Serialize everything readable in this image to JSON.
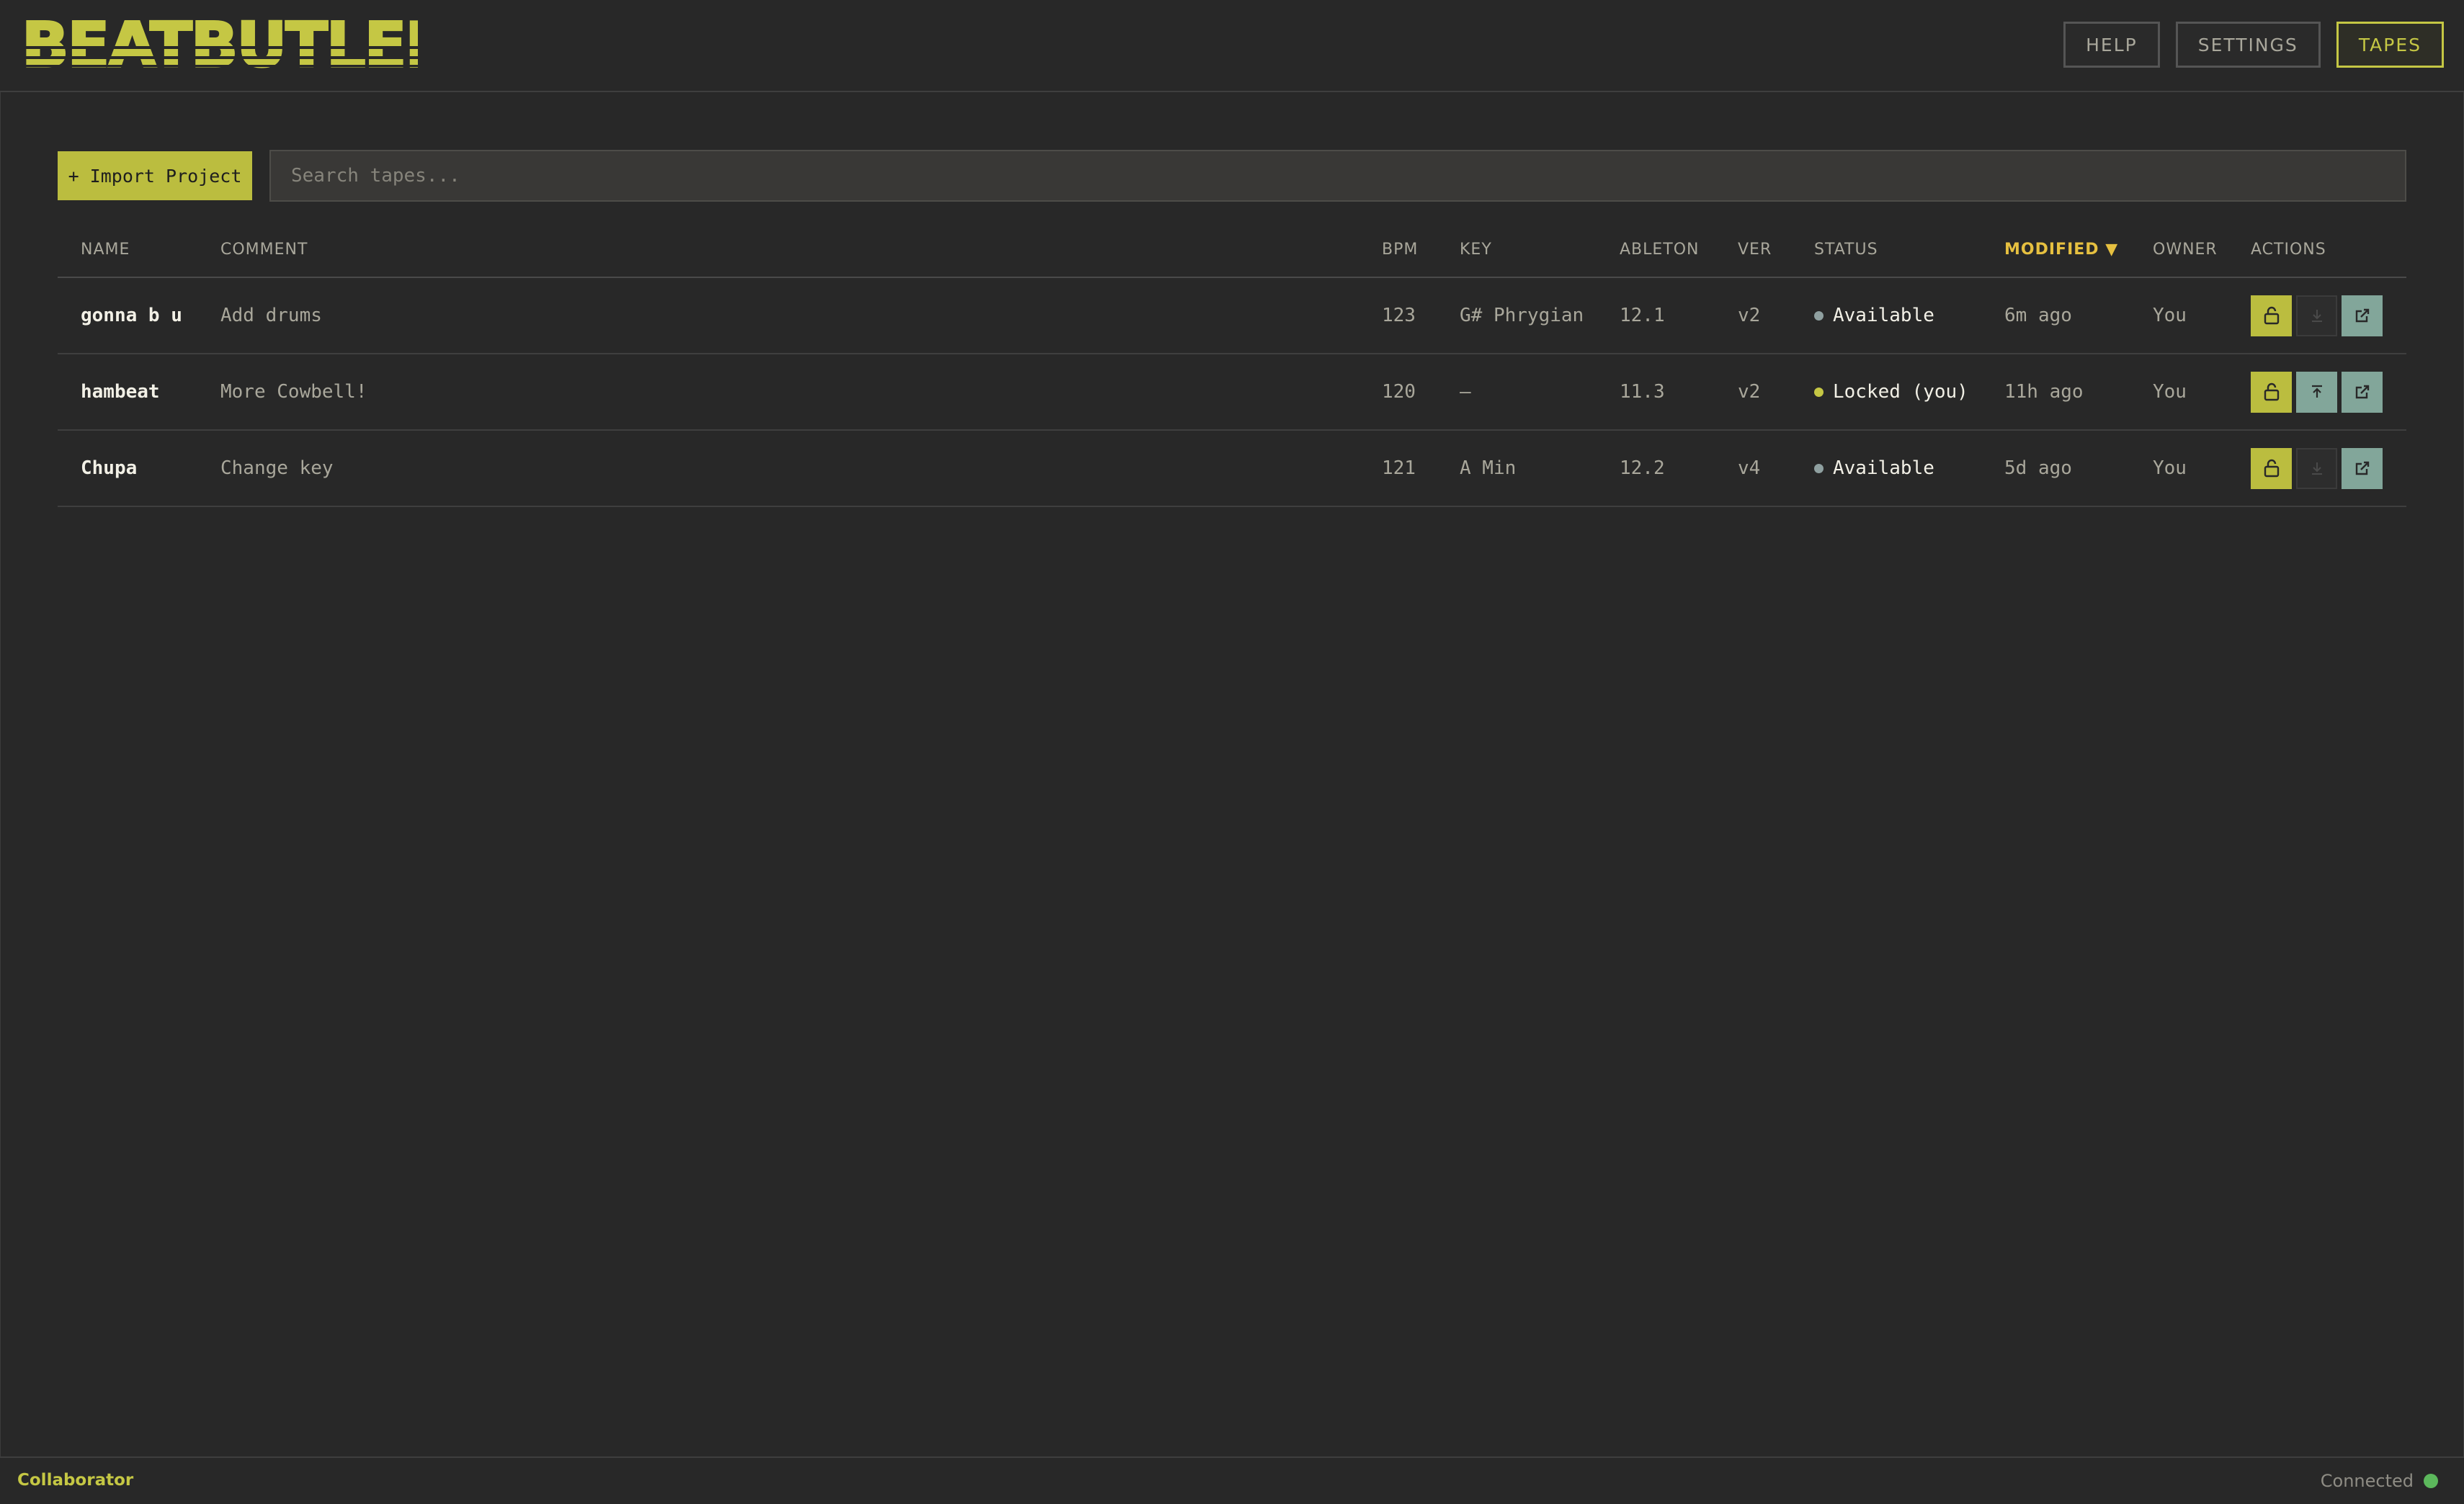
{
  "app": {
    "logo_text": "BEATBUTLER",
    "nav": [
      {
        "label": "HELP",
        "active": false
      },
      {
        "label": "SETTINGS",
        "active": false
      },
      {
        "label": "TAPES",
        "active": true
      }
    ]
  },
  "toolbar": {
    "import_label": "+ Import Project",
    "search_placeholder": "Search tapes...",
    "search_value": ""
  },
  "table": {
    "headers": {
      "name": "NAME",
      "comment": "COMMENT",
      "bpm": "BPM",
      "key": "KEY",
      "ableton": "ABLETON",
      "ver": "VER",
      "status": "STATUS",
      "modified": "MODIFIED ▼",
      "owner": "OWNER",
      "actions": "ACTIONS"
    },
    "sorted_column": "modified",
    "rows": [
      {
        "name": "gonna b u",
        "comment": "Add drums",
        "bpm": "123",
        "key": "G# Phrygian",
        "ableton": "12.1",
        "ver": "v2",
        "status": "Available",
        "modified": "6m ago",
        "owner": "You"
      },
      {
        "name": "hambeat",
        "comment": "More Cowbell!",
        "bpm": "120",
        "key": "–",
        "ableton": "11.3",
        "ver": "v2",
        "status": "Locked (you)",
        "modified": "11h ago",
        "owner": "You"
      },
      {
        "name": "Chupa",
        "comment": "Change key",
        "bpm": "121",
        "key": "A Min",
        "ableton": "12.2",
        "ver": "v4",
        "status": "Available",
        "modified": "5d ago",
        "owner": "You"
      }
    ]
  },
  "footer": {
    "role": "Collaborator",
    "connection": "Connected"
  },
  "colors": {
    "accent": "#c5c744",
    "sorted_header": "#e6c040",
    "available_dot": "#8fa0a0",
    "locked_dot": "#c5c744",
    "connected_dot": "#5cb85c"
  },
  "icons": {
    "lock": "lock-open-icon",
    "download": "download-icon",
    "upload": "upload-icon",
    "open": "external-link-icon"
  }
}
